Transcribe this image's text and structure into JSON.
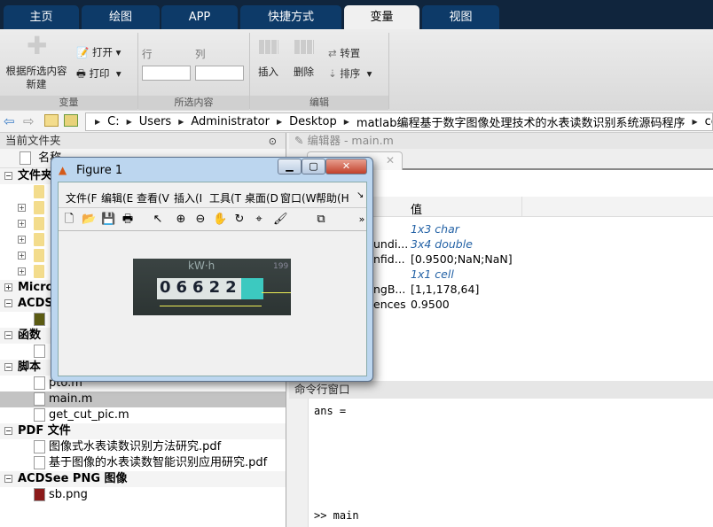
{
  "ribbon_tabs": [
    "主页",
    "绘图",
    "APP",
    "快捷方式",
    "变量",
    "视图"
  ],
  "active_tab": "变量",
  "ribbon": {
    "new_from_selection": "根据所选内容新建",
    "open": "打开",
    "print": "打印",
    "row_label": "行",
    "col_label": "列",
    "insert": "插入",
    "delete": "删除",
    "transpose": "转置",
    "sort": "排序",
    "sections": [
      "变量",
      "所选内容",
      "编辑"
    ]
  },
  "address": {
    "path": [
      "C:",
      "Users",
      "Administrator",
      "Desktop",
      "matlab编程基于数字图像处理技术的水表读数识别系统源码程序",
      "code"
    ]
  },
  "current_folder": {
    "title": "当前文件夹",
    "column_name": "名称",
    "rows": [
      {
        "type": "group",
        "label": "文件夹",
        "expanded": true
      },
      {
        "type": "folder",
        "label": "",
        "expandable": false
      },
      {
        "type": "folder",
        "label": "",
        "expandable": true
      },
      {
        "type": "folder",
        "label": "",
        "expandable": true
      },
      {
        "type": "folder",
        "label": "",
        "expandable": true
      },
      {
        "type": "folder",
        "label": "",
        "expandable": true
      },
      {
        "type": "folder",
        "label": "",
        "expandable": true
      },
      {
        "type": "group",
        "label": "Micros",
        "expanded": false
      },
      {
        "type": "group",
        "label": "ACDSe",
        "expanded": true
      },
      {
        "type": "file",
        "icon": "jpg",
        "label": ""
      },
      {
        "type": "group",
        "label": "函数",
        "expanded": true
      },
      {
        "type": "file",
        "icon": "fx",
        "label": ""
      },
      {
        "type": "group",
        "label": "脚本",
        "expanded": true
      },
      {
        "type": "file",
        "icon": "m",
        "label": "pto.m"
      },
      {
        "type": "file",
        "icon": "m",
        "label": "main.m",
        "selected": true
      },
      {
        "type": "file",
        "icon": "m",
        "label": "get_cut_pic.m"
      },
      {
        "type": "group",
        "label": "PDF 文件",
        "expanded": true
      },
      {
        "type": "file",
        "icon": "pdf",
        "label": "图像式水表读数识别方法研究.pdf"
      },
      {
        "type": "file",
        "icon": "pdf",
        "label": "基于图像的水表读数智能识别应用研究.pdf"
      },
      {
        "type": "group",
        "label": "ACDSee PNG 图像",
        "expanded": true
      },
      {
        "type": "file",
        "icon": "png",
        "label": "sb.png"
      }
    ]
  },
  "editor": {
    "title": "编辑器 - main.m"
  },
  "workspace": {
    "value_header": "值",
    "rows": [
      {
        "name": "",
        "value": "1x3 char",
        "italic": true
      },
      {
        "name": "undi...",
        "value": "3x4 double",
        "italic": true
      },
      {
        "name": "nfid...",
        "value": "[0.9500;NaN;NaN]",
        "italic": false
      },
      {
        "name": "",
        "value": "1x1 cell",
        "italic": true
      },
      {
        "name": "ngB...",
        "value": "[1,1,178,64]",
        "italic": false
      },
      {
        "name": "ences",
        "value": "0.9500",
        "italic": false
      }
    ]
  },
  "command_window": {
    "title": "命令行窗口",
    "lines": [
      "ans ="
    ],
    "prompt": ">> main"
  },
  "figure": {
    "title": "Figure 1",
    "menus": [
      "文件(F",
      "编辑(E",
      "查看(V",
      "插入(I",
      "工具(T",
      "桌面(D",
      "窗口(W",
      "帮助(H"
    ],
    "toolbar": [
      "new-icon",
      "open-icon",
      "save-icon",
      "print-icon",
      "pointer-icon",
      "zoom-in-icon",
      "zoom-out-icon",
      "pan-icon",
      "rotate-icon",
      "data-cursor-icon",
      "brush-icon",
      "link-icon"
    ],
    "image_text": {
      "unit": "kW·h",
      "reading": "06622",
      "corner": "199"
    }
  }
}
